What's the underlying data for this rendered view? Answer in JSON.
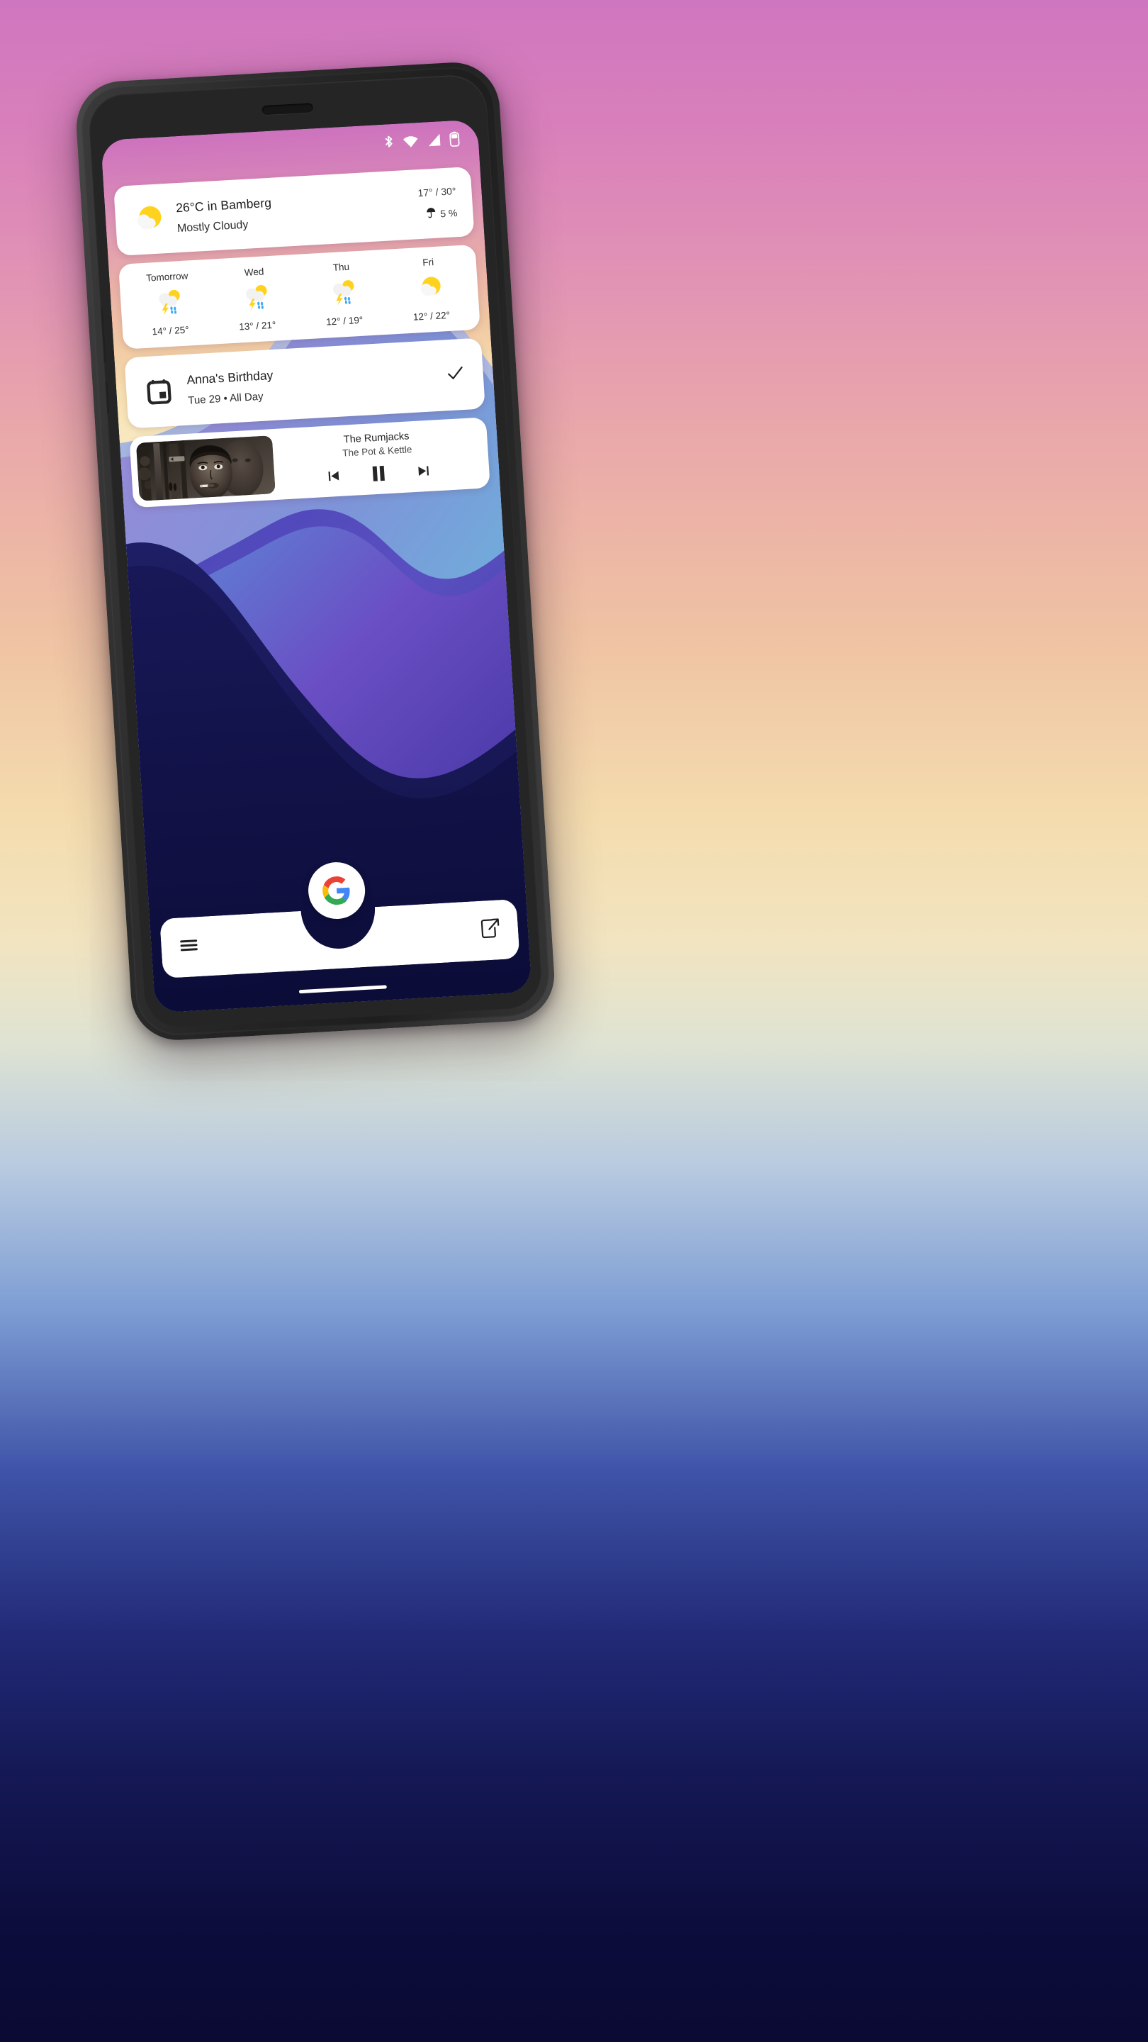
{
  "device": {
    "type": "smartphone-mockup",
    "frame_color": "#2c2c2c",
    "earpiece": "earpiece-speaker",
    "nav_gesture_bar": true
  },
  "background": {
    "top_color": "#cf76c0",
    "mid_color": "#f4dcae",
    "bottom_color": "#0a0a33"
  },
  "statusbar": {
    "icons": [
      "bluetooth-icon",
      "wifi-icon",
      "cellular-signal-icon",
      "battery-icon"
    ],
    "tint": "#ffffff"
  },
  "weather_now": {
    "icon": "sun-behind-cloud-icon",
    "temperature_line": "26°C in Bamberg",
    "condition": "Mostly Cloudy",
    "high_low": "17° / 30°",
    "precip_icon": "umbrella-icon",
    "precip": "5 %"
  },
  "forecast": {
    "days": [
      {
        "name": "Tomorrow",
        "icon": "thunderstorm-rain-icon",
        "temps": "14° / 25°"
      },
      {
        "name": "Wed",
        "icon": "thunderstorm-rain-icon",
        "temps": "13° / 21°"
      },
      {
        "name": "Thu",
        "icon": "thunderstorm-rain-icon",
        "temps": "12° / 19°"
      },
      {
        "name": "Fri",
        "icon": "sun-behind-cloud-icon",
        "temps": "12° / 22°"
      }
    ]
  },
  "calendar_event": {
    "icon": "calendar-icon",
    "title": "Anna's Birthday",
    "subtitle": "Tue 29  •  All Day",
    "action_icon": "checkmark-icon"
  },
  "media_player": {
    "album_art": "grayscale-portrait-album-art",
    "artist": "The Rumjacks",
    "track": "The Pot & Kettle",
    "controls": [
      "previous-track-icon",
      "pause-icon",
      "next-track-icon"
    ],
    "state": "playing"
  },
  "dock": {
    "assistant_icon": "google-g-logo",
    "search_menu_icon": "hamburger-menu-icon",
    "search_action_icon": "open-external-icon"
  },
  "wallpaper": {
    "style": "layered-gradient-waves",
    "layers": [
      "#9aa7e0",
      "#7f9ad8",
      "#5b5fc0",
      "#3f3fa5",
      "#1b1b5e",
      "#12124a"
    ]
  }
}
